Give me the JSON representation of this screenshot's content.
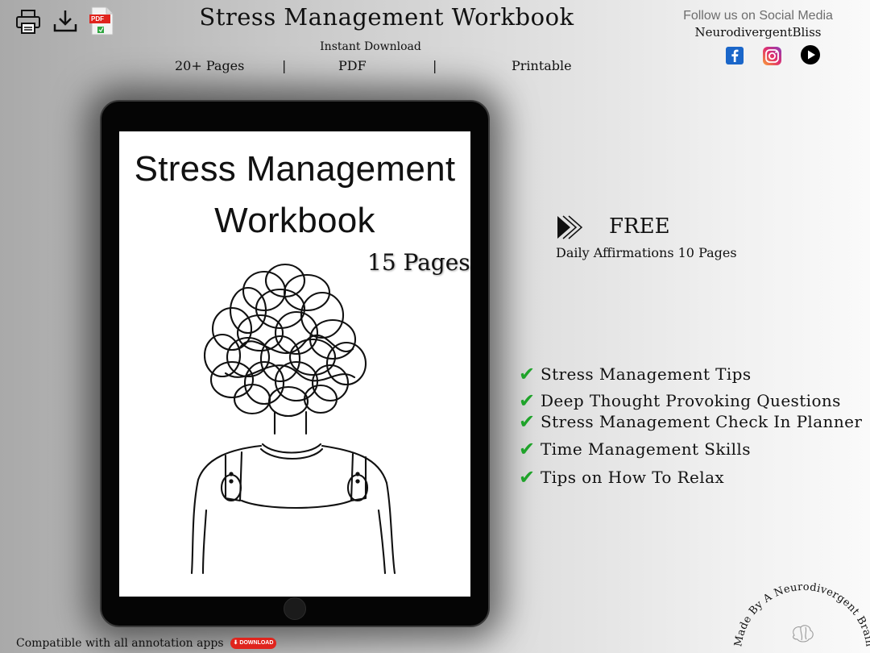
{
  "toolbar": {
    "icons": [
      "printer-icon",
      "download-icon",
      "pdf-file-icon"
    ],
    "pdf_badge": "PDF"
  },
  "header": {
    "title": "Stress Management Workbook",
    "subtitle": "Instant Download",
    "features": [
      "20+ Pages",
      "PDF",
      "Printable"
    ],
    "separator": "|"
  },
  "social": {
    "follow_text": "Follow us on Social Media",
    "handle": "NeurodivergentBliss",
    "icons": [
      "facebook-icon",
      "instagram-icon",
      "play-icon"
    ],
    "colors": {
      "facebook": "#1a66c9",
      "instagram": "#e1306c",
      "play": "#000000"
    }
  },
  "cover": {
    "title_line1": "Stress Management",
    "title_line2": "Workbook",
    "pages": "15 Pages"
  },
  "free": {
    "label": "FREE",
    "sub": "Daily Affirmations 10 Pages"
  },
  "checklist": [
    "Stress Management Tips",
    "Deep Thought Provoking Questions",
    "Stress Management Check In Planner",
    "Time Management Skills",
    "Tips on How To Relax"
  ],
  "footer": {
    "compat": "Compatible with all annotation apps",
    "download_badge": "⬇ DOWNLOAD",
    "stamp_text": "Made By A Neurodivergent Brain"
  },
  "colors": {
    "check": "#1fa32a",
    "download_badge": "#e0241d",
    "follow_text": "#6d6d6d"
  }
}
